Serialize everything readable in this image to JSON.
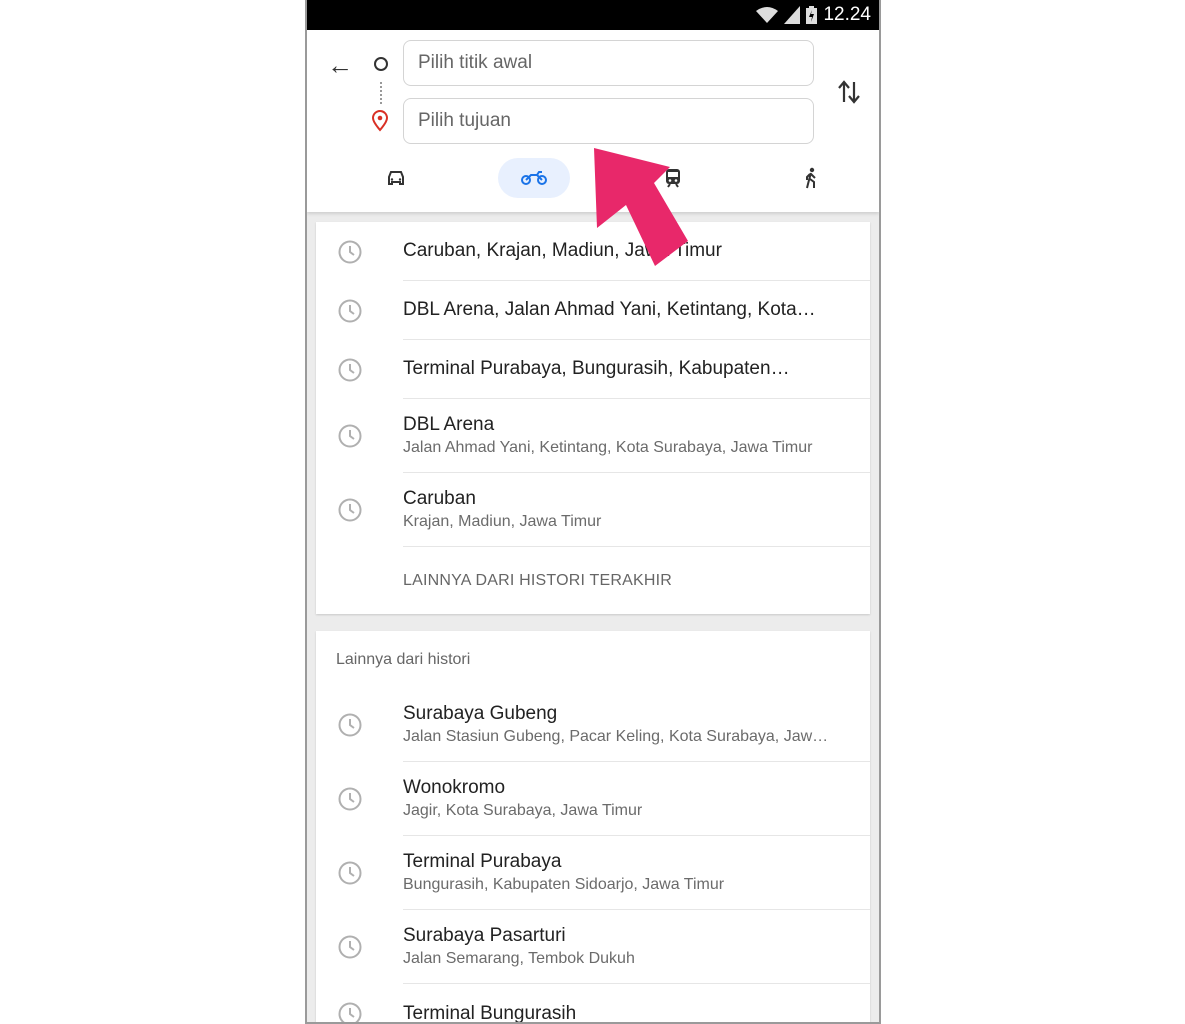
{
  "status_bar": {
    "time": "12.24"
  },
  "search": {
    "origin_placeholder": "Pilih titik awal",
    "destination_placeholder": "Pilih tujuan"
  },
  "modes": [
    {
      "name": "car",
      "active": false
    },
    {
      "name": "motorcycle",
      "active": true
    },
    {
      "name": "transit",
      "active": false
    },
    {
      "name": "walk",
      "active": false
    }
  ],
  "recent": [
    {
      "title": "Caruban, Krajan, Madiun, Jawa Timur"
    },
    {
      "title": "DBL Arena, Jalan Ahmad Yani, Ketintang, Kota…"
    },
    {
      "title": "Terminal Purabaya, Bungurasih, Kabupaten…"
    },
    {
      "title": "DBL Arena",
      "subtitle": "Jalan Ahmad Yani, Ketintang, Kota Surabaya, Jawa Timur"
    },
    {
      "title": "Caruban",
      "subtitle": "Krajan, Madiun, Jawa Timur"
    }
  ],
  "more_recent_label": "LAINNYA DARI HISTORI TERAKHIR",
  "history": {
    "heading": "Lainnya dari histori",
    "items": [
      {
        "title": "Surabaya Gubeng",
        "subtitle": "Jalan Stasiun Gubeng, Pacar Keling, Kota Surabaya, Jaw…"
      },
      {
        "title": "Wonokromo",
        "subtitle": "Jagir, Kota Surabaya, Jawa Timur"
      },
      {
        "title": "Terminal Purabaya",
        "subtitle": "Bungurasih, Kabupaten Sidoarjo, Jawa Timur"
      },
      {
        "title": "Surabaya Pasarturi",
        "subtitle": "Jalan Semarang, Tembok Dukuh"
      },
      {
        "title": "Terminal Bungurasih"
      }
    ]
  },
  "colors": {
    "accent": "#1a73e8",
    "arrow": "#e8286a",
    "pin": "#d93025"
  }
}
